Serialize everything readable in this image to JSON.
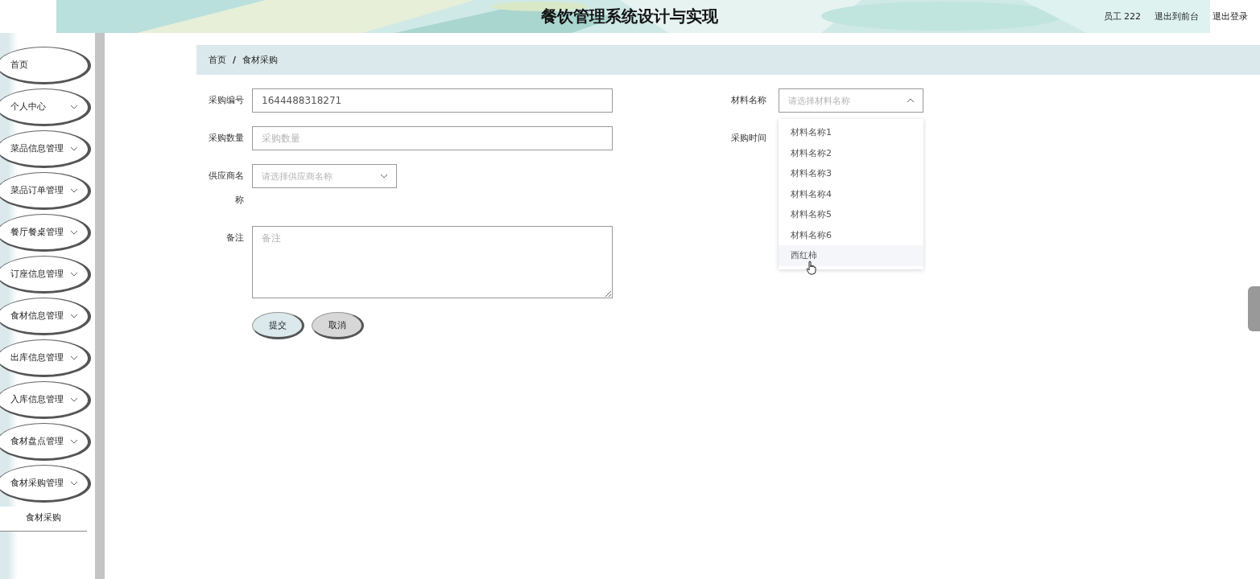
{
  "header": {
    "title": "餐饮管理系统设计与实现",
    "user": "员工 222",
    "links": [
      "退出到前台",
      "退出登录"
    ]
  },
  "sidebar": {
    "items": [
      {
        "label": "首页",
        "expandable": false
      },
      {
        "label": "个人中心",
        "expandable": true
      },
      {
        "label": "菜品信息管理",
        "expandable": true
      },
      {
        "label": "菜品订单管理",
        "expandable": true
      },
      {
        "label": "餐厅餐桌管理",
        "expandable": true
      },
      {
        "label": "订座信息管理",
        "expandable": true
      },
      {
        "label": "食材信息管理",
        "expandable": true
      },
      {
        "label": "出库信息管理",
        "expandable": true
      },
      {
        "label": "入库信息管理",
        "expandable": true
      },
      {
        "label": "食材盘点管理",
        "expandable": true
      },
      {
        "label": "食材采购管理",
        "expandable": true,
        "children": [
          {
            "label": "食材采购"
          }
        ]
      }
    ]
  },
  "breadcrumb": {
    "items": [
      "首页",
      "食材采购"
    ],
    "separator": "/"
  },
  "form": {
    "left": [
      {
        "kind": "input",
        "label": "采购编号",
        "value": "1644488318271"
      },
      {
        "kind": "input",
        "label": "采购数量",
        "placeholder": "采购数量"
      },
      {
        "kind": "select",
        "label": "供应商名称",
        "placeholder": "请选择供应商名称"
      },
      {
        "kind": "textarea",
        "label": "备注",
        "placeholder": "备注"
      }
    ],
    "right": [
      {
        "kind": "select",
        "label": "材料名称",
        "placeholder": "请选择材料名称",
        "expanded": true,
        "options": [
          {
            "label": "材料名称1",
            "hovered": false
          },
          {
            "label": "材料名称2",
            "hovered": false
          },
          {
            "label": "材料名称3",
            "hovered": false
          },
          {
            "label": "材料名称4",
            "hovered": false
          },
          {
            "label": "材料名称5",
            "hovered": false
          },
          {
            "label": "材料名称6",
            "hovered": false
          },
          {
            "label": "西红柿",
            "hovered": true
          }
        ]
      },
      {
        "kind": "label",
        "label": "采购时间"
      }
    ],
    "buttons": [
      {
        "label": "提交",
        "kind": "primary"
      },
      {
        "label": "取消",
        "kind": "secondary"
      }
    ]
  }
}
